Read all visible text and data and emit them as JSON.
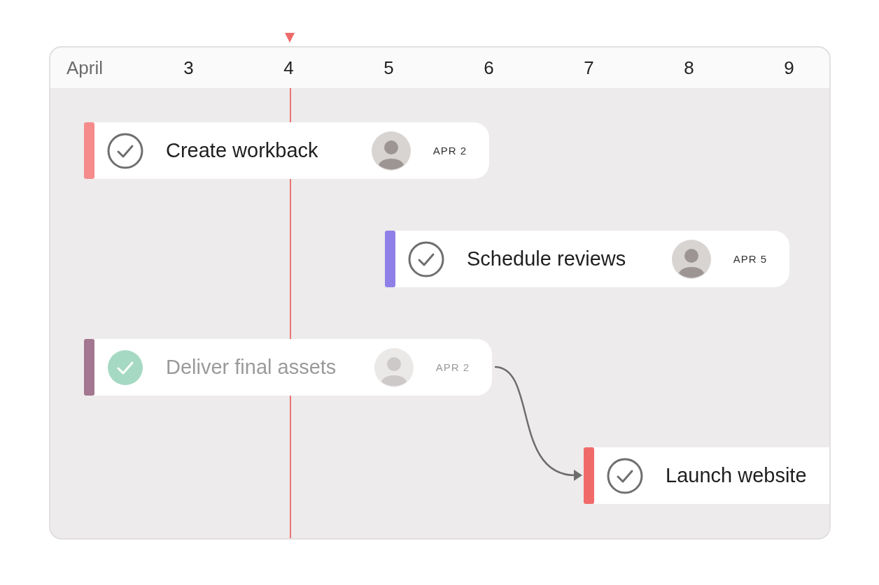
{
  "timeline": {
    "month": "April",
    "days": [
      "3",
      "4",
      "5",
      "6",
      "7",
      "8",
      "9"
    ]
  },
  "tasks": [
    {
      "title": "Create workback",
      "date": "APR 2",
      "color": "#f58b8b",
      "done": false,
      "blocked_by_previous": false
    },
    {
      "title": "Schedule reviews",
      "date": "APR 5",
      "color": "#8f80e8",
      "done": false,
      "blocked_by_previous": false
    },
    {
      "title": "Deliver final assets",
      "date": "APR 2",
      "color": "#a2778f",
      "done": true,
      "blocked_by_previous": false
    },
    {
      "title": "Launch website",
      "color": "#f06a6a",
      "done": false,
      "blocked_by_previous": true
    }
  ]
}
